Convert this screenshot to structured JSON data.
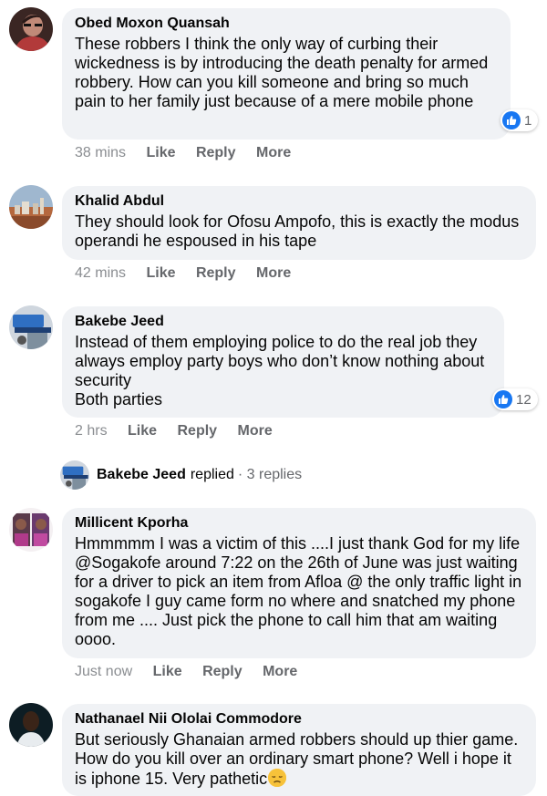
{
  "comments": [
    {
      "author": "Obed Moxon Quansah",
      "text": "These robbers I think the only way of curbing their wickedness is by introducing the death penalty for armed robbery. How can you kill someone and bring so much pain to her family just because of a mere mobile phone",
      "time": "38 mins",
      "reaction_count": "1"
    },
    {
      "author": "Khalid Abdul",
      "text": "They should look for Ofosu Ampofo, this is exactly the modus operandi he espoused in his tape",
      "time": "42 mins"
    },
    {
      "author": "Bakebe Jeed",
      "text_lines": [
        "Instead of them employing police to do the real job they always employ party boys who don’t know nothing about security",
        "Both parties"
      ],
      "time": "2 hrs",
      "reaction_count": "12"
    },
    {
      "author": "Millicent Kporha",
      "text": "Hmmmmm I was a victim of this ....I just thank God for my life @Sogakofe around 7:22 on the 26th of June was just waiting for a driver to pick an item from Afloa @ the only traffic light in sogakofe I guy came form no where and snatched my phone from me .... Just pick the phone to call him that am waiting oooo.",
      "time": "Just now"
    },
    {
      "author": "Nathanael Nii Ololai Commodore",
      "text": "But seriously Ghanaian armed robbers should up thier game. How do you kill over an ordinary smart phone? Well i hope it is iphone 15. Very pathetic",
      "emoji": "disappointed-face"
    }
  ],
  "actions": {
    "like": "Like",
    "reply": "Reply",
    "more": "More"
  },
  "replies_summary": {
    "name": "Bakebe Jeed",
    "verb": "replied",
    "count": "· 3 replies"
  },
  "colors": {
    "bubble": "#f0f2f5",
    "like_blue": "#1877f2",
    "meta_gray": "#65676b"
  }
}
